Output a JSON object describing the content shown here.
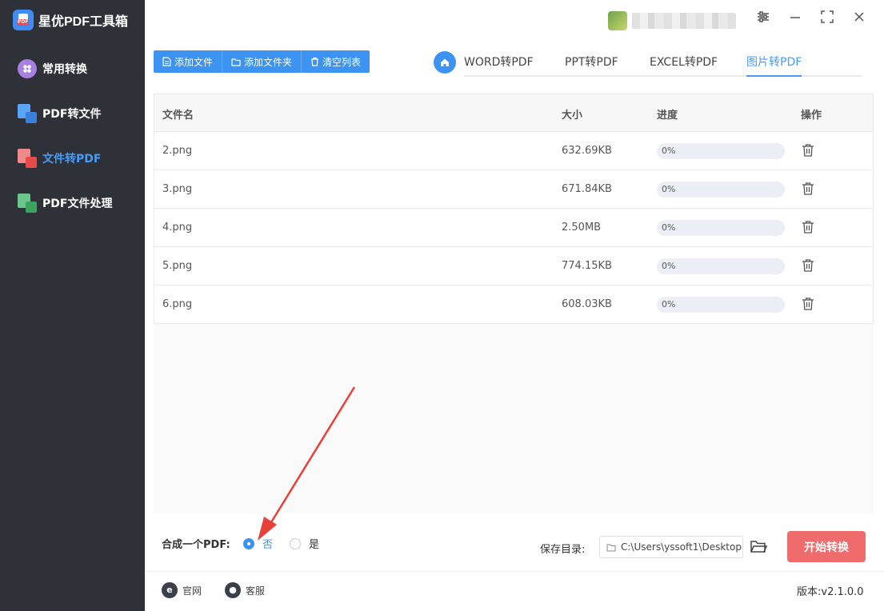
{
  "app": {
    "title": "星优PDF工具箱"
  },
  "sidebar": {
    "items": [
      {
        "label": "常用转换",
        "icon": "grid-icon",
        "active": false
      },
      {
        "label": "PDF转文件",
        "icon": "pdf-to-file-icon",
        "active": false
      },
      {
        "label": "文件转PDF",
        "icon": "file-to-pdf-icon",
        "active": true
      },
      {
        "label": "PDF文件处理",
        "icon": "pdf-process-icon",
        "active": false
      }
    ]
  },
  "toolbar": {
    "add_file": "添加文件",
    "add_folder": "添加文件夹",
    "clear_list": "清空列表"
  },
  "tabs": [
    {
      "label": "WORD转PDF",
      "active": false
    },
    {
      "label": "PPT转PDF",
      "active": false
    },
    {
      "label": "EXCEL转PDF",
      "active": false
    },
    {
      "label": "图片转PDF",
      "active": true
    }
  ],
  "table": {
    "headers": {
      "name": "文件名",
      "size": "大小",
      "progress": "进度",
      "action": "操作"
    },
    "rows": [
      {
        "name": "2.png",
        "size": "632.69KB",
        "progress": "0%",
        "progress_value": 0
      },
      {
        "name": "3.png",
        "size": "671.84KB",
        "progress": "0%",
        "progress_value": 0
      },
      {
        "name": "4.png",
        "size": "2.50MB",
        "progress": "0%",
        "progress_value": 0
      },
      {
        "name": "5.png",
        "size": "774.15KB",
        "progress": "0%",
        "progress_value": 0
      },
      {
        "name": "6.png",
        "size": "608.03KB",
        "progress": "0%",
        "progress_value": 0
      }
    ]
  },
  "merge": {
    "label": "合成一个PDF:",
    "option_no": "否",
    "option_yes": "是",
    "selected": "否"
  },
  "save": {
    "label": "保存目录:",
    "path": "C:\\Users\\yssoft1\\Desktop"
  },
  "start_button": "开始转换",
  "footer": {
    "website": "官网",
    "support": "客服",
    "version": "版本:v2.1.0.0"
  },
  "colors": {
    "accent": "#3d93f2",
    "sidebar_bg": "#2e3138",
    "start_button": "#f06b6b",
    "annotation_arrow": "#e8413a"
  }
}
